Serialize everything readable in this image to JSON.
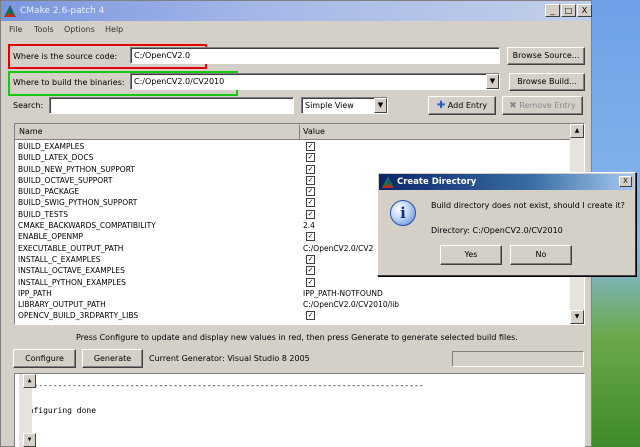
{
  "window": {
    "title": "CMake 2.6-patch 4",
    "controls": [
      "_",
      "□",
      "X"
    ]
  },
  "menu": [
    "File",
    "Tools",
    "Options",
    "Help"
  ],
  "source": {
    "label": "Where is the source code:",
    "value": "C:/OpenCV2.0",
    "browse": "Browse Source...",
    "highlight_color": "#e30000"
  },
  "build": {
    "label": "Where to build the binaries:",
    "value": "C:/OpenCV2.0/CV2010",
    "browse": "Browse Build...",
    "highlight_color": "#16c80f"
  },
  "search": {
    "label": "Search:",
    "value": "",
    "view_mode": "Simple View",
    "add_entry": "Add Entry",
    "remove_entry": "Remove Entry"
  },
  "table": {
    "columns": [
      "Name",
      "Value"
    ],
    "rows": [
      {
        "name": "BUILD_EXAMPLES",
        "value": "",
        "checked": true
      },
      {
        "name": "BUILD_LATEX_DOCS",
        "value": "",
        "checked": true
      },
      {
        "name": "BUILD_NEW_PYTHON_SUPPORT",
        "value": "",
        "checked": true
      },
      {
        "name": "BUILD_OCTAVE_SUPPORT",
        "value": "",
        "checked": true
      },
      {
        "name": "BUILD_PACKAGE",
        "value": "",
        "checked": true
      },
      {
        "name": "BUILD_SWIG_PYTHON_SUPPORT",
        "value": "",
        "checked": true
      },
      {
        "name": "BUILD_TESTS",
        "value": "",
        "checked": true
      },
      {
        "name": "CMAKE_BACKWARDS_COMPATIBILITY",
        "value": "2.4",
        "checked": null
      },
      {
        "name": "ENABLE_OPENMP",
        "value": "",
        "checked": true
      },
      {
        "name": "EXECUTABLE_OUTPUT_PATH",
        "value": "C:/OpenCV2.0/CV2",
        "checked": null
      },
      {
        "name": "INSTALL_C_EXAMPLES",
        "value": "",
        "checked": true
      },
      {
        "name": "INSTALL_OCTAVE_EXAMPLES",
        "value": "",
        "checked": true
      },
      {
        "name": "INSTALL_PYTHON_EXAMPLES",
        "value": "",
        "checked": true
      },
      {
        "name": "IPP_PATH",
        "value": "IPP_PATH-NOTFOUND",
        "checked": null
      },
      {
        "name": "LIBRARY_OUTPUT_PATH",
        "value": "C:/OpenCV2.0/CV2010/lib",
        "checked": null
      },
      {
        "name": "OPENCV_BUILD_3RDPARTY_LIBS",
        "value": "",
        "checked": true
      }
    ]
  },
  "hint": "Press Configure to update and display new values in red, then press Generate to generate selected build files.",
  "actions": {
    "configure": "Configure",
    "generate": "Generate",
    "generator": "Current Generator: Visual Studio 8 2005"
  },
  "output": {
    "lines": [
      "------------------------------------------------------------------------------------",
      "Configuring done"
    ]
  },
  "dialog": {
    "title": "Create Directory",
    "message": "Build directory does not exist, should I create it?",
    "detail": "Directory: C:/OpenCV2.0/CV2010",
    "yes": "Yes",
    "no": "No",
    "close": "X",
    "icon": "info-icon"
  }
}
